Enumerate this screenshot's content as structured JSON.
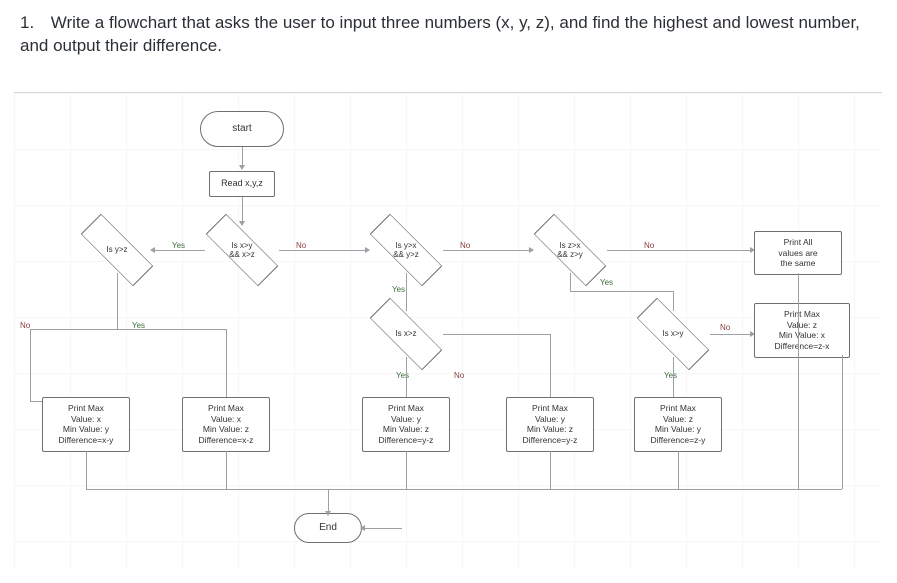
{
  "question": {
    "number": "1.",
    "text": "Write a flowchart that asks the user to input three numbers (x, y, z), and find the highest and lowest number, and output their difference."
  },
  "nodes": {
    "start": "start",
    "read": "Read x,y,z",
    "d_y_gt_z": "Is y>z",
    "d_xgty_xgtz": "Is x>y\n&& x>z",
    "d_ygtx_ygtz": "Is y>x\n&& y>z",
    "d_zgtx_zgty": "Is z>x\n&& z>y",
    "d_x_gt_z": "Is x>z",
    "d_x_gt_y": "Is x>y",
    "out_all_same": "Print All\nvalues are\nthe same",
    "out_zx": "Print Max\nValue: z\nMin Value: x\nDifference=z-x",
    "out_xy": "Print Max\nValue: x\nMin Value: y\nDifference=x-y",
    "out_xz": "Print Max\nValue: x\nMin Value: z\nDifference=x-z",
    "out_yz": "Print Max\nValue: y\nMin Value: z\nDifference=y-z",
    "out_yz2": "Print Max\nValue: y\nMin Value: z\nDifference=y-z",
    "out_zy": "Print Max\nValue: z\nMin Value: y\nDifference=z-y",
    "end": "End"
  },
  "labels": {
    "yes": "Yes",
    "no": "No"
  }
}
